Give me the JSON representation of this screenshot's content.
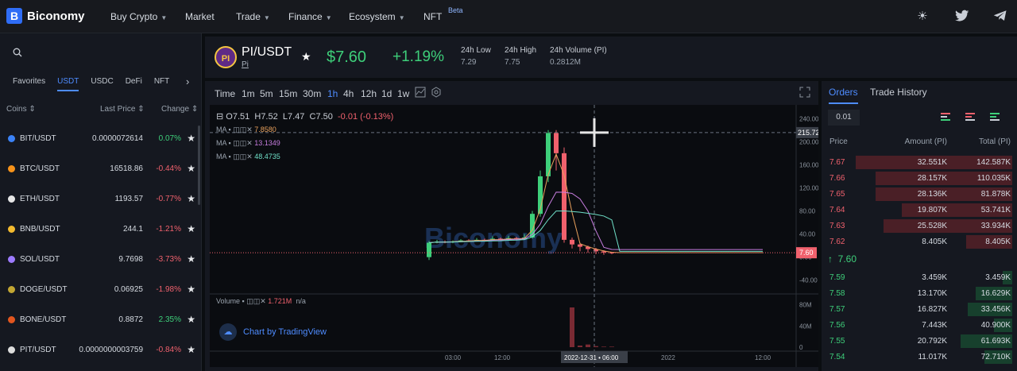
{
  "brand": {
    "name": "Biconomy",
    "logo_letter": "B"
  },
  "nav": {
    "items": [
      "Buy Crypto",
      "Market",
      "Trade",
      "Finance",
      "Ecosystem",
      "NFT"
    ],
    "beta": "Beta"
  },
  "sidebar": {
    "tabs": [
      "Favorites",
      "USDT",
      "USDC",
      "DeFi",
      "NFT"
    ],
    "active_tab": "USDT",
    "col_coins": "Coins",
    "col_price": "Last Price",
    "col_change": "Change",
    "coins": [
      {
        "pair": "BIT/USDT",
        "price": "0.0000072614",
        "change": "0.07%",
        "up": true,
        "color": "#3b82f6"
      },
      {
        "pair": "BTC/USDT",
        "price": "16518.86",
        "change": "-0.44%",
        "up": false,
        "color": "#f7931a"
      },
      {
        "pair": "ETH/USDT",
        "price": "1193.57",
        "change": "-0.77%",
        "up": false,
        "color": "#e6e6e6"
      },
      {
        "pair": "BNB/USDT",
        "price": "244.1",
        "change": "-1.21%",
        "up": false,
        "color": "#f3ba2f"
      },
      {
        "pair": "SOL/USDT",
        "price": "9.7698",
        "change": "-3.73%",
        "up": false,
        "color": "#9d7bff"
      },
      {
        "pair": "DOGE/USDT",
        "price": "0.06925",
        "change": "-1.98%",
        "up": false,
        "color": "#c2a633"
      },
      {
        "pair": "BONE/USDT",
        "price": "0.8872",
        "change": "2.35%",
        "up": true,
        "color": "#e2561f"
      },
      {
        "pair": "PIT/USDT",
        "price": "0.0000000003759",
        "change": "-0.84%",
        "up": false,
        "color": "#dddddd"
      }
    ]
  },
  "header": {
    "pair": "PI/USDT",
    "sub": "Pi",
    "icon": "PI",
    "price": "$7.60",
    "change": "+1.19%",
    "low_label": "24h Low",
    "low": "7.29",
    "high_label": "24h High",
    "high": "7.75",
    "vol_label": "24h Volume (PI)",
    "vol": "0.2812M"
  },
  "timeframes": [
    "Time",
    "1m",
    "5m",
    "15m",
    "30m",
    "1h",
    "4h",
    "12h",
    "1d",
    "1w"
  ],
  "active_tf": "1h",
  "chart_data": {
    "type": "candlestick",
    "ohlc": {
      "o": "O7.51",
      "h": "H7.52",
      "l": "L7.47",
      "c": "C7.50",
      "chg": "-0.01 (-0.13%)"
    },
    "ma": [
      {
        "label": "MA",
        "value": "7.8580",
        "color": "#e8a05c"
      },
      {
        "label": "MA",
        "value": "13.1349",
        "color": "#c77ddf"
      },
      {
        "label": "MA",
        "value": "48.4735",
        "color": "#6fe0c8"
      }
    ],
    "y_ticks": [
      "240.00",
      "220.00",
      "200.00",
      "160.00",
      "120.00",
      "80.00",
      "40.00",
      "0.00",
      "-40.00"
    ],
    "y_range": [
      -50,
      250
    ],
    "crosshair_value": "215.72",
    "last_price": "7.60",
    "x_ticks": [
      "03:00",
      "12:00",
      "2022",
      "12:00"
    ],
    "crosshair_time": "2022-12-31 • 06:00",
    "volume_label": "Volume",
    "volume_value": "1.721M",
    "volume_na": "n/a",
    "volume_ticks": [
      "80M",
      "40M",
      "0"
    ],
    "watermark": "Biconomy",
    "tv_label": "Chart by TradingView",
    "candles": [
      {
        "o": 0,
        "c": 25,
        "l": -5,
        "h": 28
      },
      {
        "o": 25,
        "c": 27,
        "l": 24,
        "h": 30
      },
      {
        "o": 27,
        "c": 26,
        "l": 24,
        "h": 29
      },
      {
        "o": 26,
        "c": 27,
        "l": 24,
        "h": 29
      },
      {
        "o": 27,
        "c": 29,
        "l": 26,
        "h": 31
      },
      {
        "o": 29,
        "c": 28,
        "l": 26,
        "h": 31
      },
      {
        "o": 28,
        "c": 30,
        "l": 27,
        "h": 33
      },
      {
        "o": 30,
        "c": 29,
        "l": 27,
        "h": 32
      },
      {
        "o": 29,
        "c": 32,
        "l": 28,
        "h": 36
      },
      {
        "o": 32,
        "c": 30,
        "l": 28,
        "h": 34
      },
      {
        "o": 30,
        "c": 33,
        "l": 29,
        "h": 37
      },
      {
        "o": 33,
        "c": 31,
        "l": 29,
        "h": 35
      },
      {
        "o": 31,
        "c": 34,
        "l": 30,
        "h": 40
      },
      {
        "o": 34,
        "c": 75,
        "l": 32,
        "h": 80
      },
      {
        "o": 75,
        "c": 140,
        "l": 70,
        "h": 150
      },
      {
        "o": 140,
        "c": 215,
        "l": 130,
        "h": 220
      },
      {
        "o": 215,
        "c": 180,
        "l": 150,
        "h": 220
      },
      {
        "o": 180,
        "c": 30,
        "l": 25,
        "h": 190
      },
      {
        "o": 30,
        "c": 22,
        "l": 15,
        "h": 34
      },
      {
        "o": 22,
        "c": 18,
        "l": 10,
        "h": 25
      },
      {
        "o": 18,
        "c": 14,
        "l": 8,
        "h": 20
      },
      {
        "o": 14,
        "c": 10,
        "l": 5,
        "h": 16
      },
      {
        "o": 10,
        "c": 8,
        "l": 4,
        "h": 12
      },
      {
        "o": 8,
        "c": 7.6,
        "l": 5,
        "h": 9
      }
    ],
    "volumes": [
      0,
      0,
      0,
      0,
      0,
      0,
      0,
      0,
      0,
      0,
      0,
      0,
      0,
      0,
      0,
      0,
      0,
      0,
      75,
      3,
      5,
      2,
      1,
      1
    ]
  },
  "orders": {
    "tabs": [
      "Orders",
      "Trade History"
    ],
    "precision": "0.01",
    "col_price": "Price",
    "col_amount": "Amount (PI)",
    "col_total": "Total (PI)",
    "asks": [
      {
        "p": "7.67",
        "a": "32.551K",
        "t": "142.587K",
        "d": 0.85
      },
      {
        "p": "7.66",
        "a": "28.157K",
        "t": "110.035K",
        "d": 0.74
      },
      {
        "p": "7.65",
        "a": "28.136K",
        "t": "81.878K",
        "d": 0.74
      },
      {
        "p": "7.64",
        "a": "19.807K",
        "t": "53.741K",
        "d": 0.6
      },
      {
        "p": "7.63",
        "a": "25.528K",
        "t": "33.934K",
        "d": 0.7
      },
      {
        "p": "7.62",
        "a": "8.405K",
        "t": "8.405K",
        "d": 0.25
      }
    ],
    "mid": "7.60",
    "bids": [
      {
        "p": "7.59",
        "a": "3.459K",
        "t": "3.459K",
        "d": 0.05
      },
      {
        "p": "7.58",
        "a": "13.170K",
        "t": "16.629K",
        "d": 0.2
      },
      {
        "p": "7.57",
        "a": "16.827K",
        "t": "33.456K",
        "d": 0.24
      },
      {
        "p": "7.56",
        "a": "7.443K",
        "t": "40.900K",
        "d": 0.1
      },
      {
        "p": "7.55",
        "a": "20.792K",
        "t": "61.693K",
        "d": 0.28
      },
      {
        "p": "7.54",
        "a": "11.017K",
        "t": "72.710K",
        "d": 0.15
      }
    ]
  },
  "colors": {
    "up": "#3ecf7a",
    "down": "#f0616d",
    "accent": "#4e8cff"
  }
}
